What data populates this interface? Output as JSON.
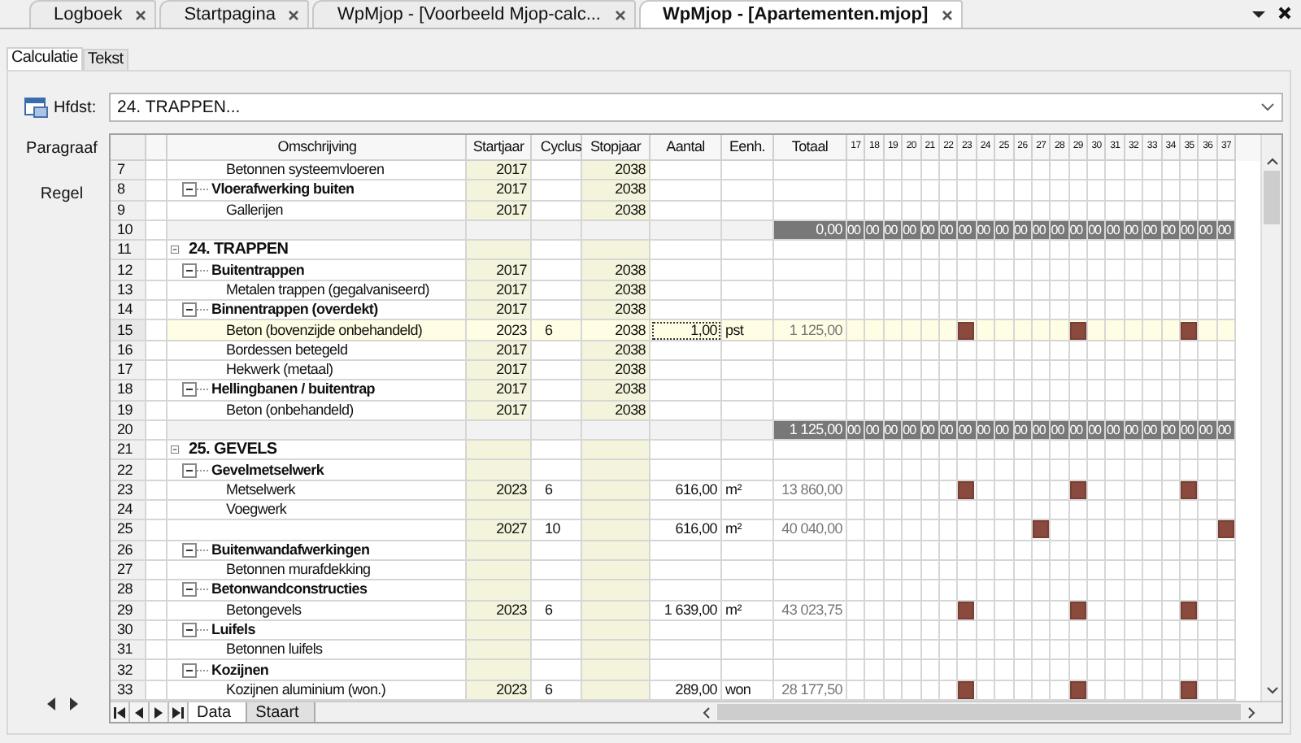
{
  "doc_tabs": [
    {
      "label": "Logboek",
      "selected": false
    },
    {
      "label": "Startpagina",
      "selected": false
    },
    {
      "label": "WpMjop - [Voorbeeld Mjop-calc...",
      "selected": false
    },
    {
      "label": "WpMjop - [Apartementen.mjop]",
      "selected": true
    }
  ],
  "sub_tabs": [
    {
      "label": "Calculatie",
      "selected": true
    },
    {
      "label": "Tekst",
      "selected": false
    }
  ],
  "side": {
    "hfdst_label": "Hfdst:",
    "paragraaf": "Paragraaf",
    "regel": "Regel"
  },
  "hfdst_value": "24. TRAPPEN...",
  "columns": [
    "Omschrijving",
    "Startjaar",
    "Cyclus",
    "Stopjaar",
    "Aantal",
    "Eenh.",
    "Totaal"
  ],
  "years": [
    "17",
    "18",
    "19",
    "20",
    "21",
    "22",
    "23",
    "24",
    "25",
    "26",
    "27",
    "28",
    "29",
    "30",
    "31",
    "32",
    "33",
    "34",
    "35",
    "36",
    "37"
  ],
  "rows": [
    {
      "num": "7",
      "kind": "item",
      "label": "Betonnen systeemvloeren",
      "start": "2017",
      "cyclus": "",
      "stop": "2038",
      "aantal": "",
      "eenh": "",
      "totaal": "",
      "selected": false
    },
    {
      "num": "8",
      "kind": "group",
      "label": "Vloerafwerking buiten",
      "start": "2017",
      "cyclus": "",
      "stop": "2038",
      "aantal": "",
      "eenh": "",
      "totaal": "",
      "selected": false
    },
    {
      "num": "9",
      "kind": "item",
      "label": "Gallerijen",
      "start": "2017",
      "cyclus": "",
      "stop": "2038",
      "aantal": "",
      "eenh": "",
      "totaal": "",
      "selected": false
    },
    {
      "num": "10",
      "kind": "total",
      "totaal": "0,00",
      "year_values": [
        "00",
        "00",
        "00",
        "00",
        "00",
        "00",
        "00",
        "00",
        "00",
        "00",
        "00",
        "00",
        "00",
        "00",
        "00",
        "00",
        "00",
        "00",
        "00",
        "00",
        "00"
      ],
      "selected": false
    },
    {
      "num": "11",
      "kind": "chapter",
      "label": "24. TRAPPEN",
      "start": "",
      "cyclus": "",
      "stop": "",
      "aantal": "",
      "eenh": "",
      "totaal": "",
      "selected": false
    },
    {
      "num": "12",
      "kind": "group",
      "label": "Buitentrappen",
      "start": "2017",
      "cyclus": "",
      "stop": "2038",
      "aantal": "",
      "eenh": "",
      "totaal": "",
      "selected": false
    },
    {
      "num": "13",
      "kind": "item",
      "label": "Metalen trappen (gegalvaniseerd)",
      "start": "2017",
      "cyclus": "",
      "stop": "2038",
      "aantal": "",
      "eenh": "",
      "totaal": "",
      "selected": false
    },
    {
      "num": "14",
      "kind": "group",
      "label": "Binnentrappen (overdekt)",
      "start": "2017",
      "cyclus": "",
      "stop": "2038",
      "aantal": "",
      "eenh": "",
      "totaal": "",
      "selected": false
    },
    {
      "num": "15",
      "kind": "item",
      "label": "Beton (bovenzijde onbehandeld)",
      "start": "2023",
      "cyclus": "6",
      "stop": "2038",
      "aantal": "1,00",
      "eenh": "pst",
      "totaal": "1 125,00",
      "selected": true,
      "planned": [
        false,
        false,
        false,
        false,
        false,
        false,
        true,
        false,
        false,
        false,
        false,
        false,
        true,
        false,
        false,
        false,
        false,
        false,
        true,
        false,
        false
      ]
    },
    {
      "num": "16",
      "kind": "item",
      "label": "Bordessen betegeld",
      "start": "2017",
      "cyclus": "",
      "stop": "2038",
      "aantal": "",
      "eenh": "",
      "totaal": "",
      "selected": false
    },
    {
      "num": "17",
      "kind": "item",
      "label": "Hekwerk (metaal)",
      "start": "2017",
      "cyclus": "",
      "stop": "2038",
      "aantal": "",
      "eenh": "",
      "totaal": "",
      "selected": false
    },
    {
      "num": "18",
      "kind": "group",
      "label": "Hellingbanen / buitentrap",
      "start": "2017",
      "cyclus": "",
      "stop": "2038",
      "aantal": "",
      "eenh": "",
      "totaal": "",
      "selected": false
    },
    {
      "num": "19",
      "kind": "item",
      "label": "Beton (onbehandeld)",
      "start": "2017",
      "cyclus": "",
      "stop": "2038",
      "aantal": "",
      "eenh": "",
      "totaal": "",
      "selected": false
    },
    {
      "num": "20",
      "kind": "total",
      "totaal": "1 125,00",
      "year_values": [
        "00",
        "00",
        "00",
        "00",
        "00",
        "00",
        "00",
        "00",
        "00",
        "00",
        "00",
        "00",
        "00",
        "00",
        "00",
        "00",
        "00",
        "00",
        "00",
        "00",
        "00"
      ],
      "selected": false
    },
    {
      "num": "21",
      "kind": "chapter",
      "label": "25. GEVELS",
      "start": "",
      "cyclus": "",
      "stop": "",
      "aantal": "",
      "eenh": "",
      "totaal": "",
      "selected": false
    },
    {
      "num": "22",
      "kind": "group",
      "label": "Gevelmetselwerk",
      "start": "",
      "cyclus": "",
      "stop": "",
      "aantal": "",
      "eenh": "",
      "totaal": "",
      "selected": false
    },
    {
      "num": "23",
      "kind": "item",
      "label": "Metselwerk",
      "start": "2023",
      "cyclus": "6",
      "stop": "",
      "aantal": "616,00",
      "eenh": "m²",
      "totaal": "13 860,00",
      "selected": false,
      "planned": [
        false,
        false,
        false,
        false,
        false,
        false,
        true,
        false,
        false,
        false,
        false,
        false,
        true,
        false,
        false,
        false,
        false,
        false,
        true,
        false,
        false
      ]
    },
    {
      "num": "24",
      "kind": "item",
      "label": "Voegwerk",
      "start": "",
      "cyclus": "",
      "stop": "",
      "aantal": "",
      "eenh": "",
      "totaal": "",
      "selected": false
    },
    {
      "num": "25",
      "kind": "item",
      "label": "",
      "start": "2027",
      "cyclus": "10",
      "stop": "",
      "aantal": "616,00",
      "eenh": "m²",
      "totaal": "40 040,00",
      "selected": false,
      "planned": [
        false,
        false,
        false,
        false,
        false,
        false,
        false,
        false,
        false,
        false,
        true,
        false,
        false,
        false,
        false,
        false,
        false,
        false,
        false,
        false,
        true
      ]
    },
    {
      "num": "26",
      "kind": "group",
      "label": "Buitenwandafwerkingen",
      "start": "",
      "cyclus": "",
      "stop": "",
      "aantal": "",
      "eenh": "",
      "totaal": "",
      "selected": false
    },
    {
      "num": "27",
      "kind": "item",
      "label": "Betonnen murafdekking",
      "start": "",
      "cyclus": "",
      "stop": "",
      "aantal": "",
      "eenh": "",
      "totaal": "",
      "selected": false
    },
    {
      "num": "28",
      "kind": "group",
      "label": "Betonwandconstructies",
      "start": "",
      "cyclus": "",
      "stop": "",
      "aantal": "",
      "eenh": "",
      "totaal": "",
      "selected": false
    },
    {
      "num": "29",
      "kind": "item",
      "label": "Betongevels",
      "start": "2023",
      "cyclus": "6",
      "stop": "",
      "aantal": "1 639,00",
      "eenh": "m²",
      "totaal": "43 023,75",
      "selected": false,
      "planned": [
        false,
        false,
        false,
        false,
        false,
        false,
        true,
        false,
        false,
        false,
        false,
        false,
        true,
        false,
        false,
        false,
        false,
        false,
        true,
        false,
        false
      ]
    },
    {
      "num": "30",
      "kind": "group",
      "label": "Luifels",
      "start": "",
      "cyclus": "",
      "stop": "",
      "aantal": "",
      "eenh": "",
      "totaal": "",
      "selected": false
    },
    {
      "num": "31",
      "kind": "item",
      "label": "Betonnen luifels",
      "start": "",
      "cyclus": "",
      "stop": "",
      "aantal": "",
      "eenh": "",
      "totaal": "",
      "selected": false
    },
    {
      "num": "32",
      "kind": "group",
      "label": "Kozijnen",
      "start": "",
      "cyclus": "",
      "stop": "",
      "aantal": "",
      "eenh": "",
      "totaal": "",
      "selected": false
    },
    {
      "num": "33",
      "kind": "item",
      "label": "Kozijnen aluminium (won.)",
      "start": "2023",
      "cyclus": "6",
      "stop": "",
      "aantal": "289,00",
      "eenh": "won",
      "totaal": "28 177,50",
      "selected": false,
      "planned": [
        false,
        false,
        false,
        false,
        false,
        false,
        true,
        false,
        false,
        false,
        false,
        false,
        true,
        false,
        false,
        false,
        false,
        false,
        true,
        false,
        false
      ]
    }
  ],
  "sheet_tabs": [
    {
      "label": "Data",
      "selected": true
    },
    {
      "label": "Staart",
      "selected": false
    }
  ]
}
